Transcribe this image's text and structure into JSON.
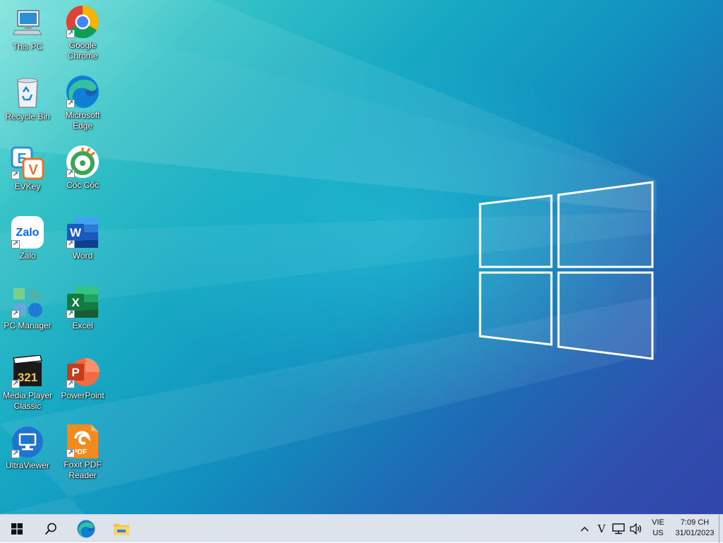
{
  "desktop": {
    "icons": [
      {
        "label": "This PC",
        "icon": "computer-icon",
        "shortcut": false
      },
      {
        "label": "Google Chrome",
        "icon": "chrome-icon",
        "shortcut": true
      },
      {
        "label": "Recycle Bin",
        "icon": "recycle-bin-icon",
        "shortcut": false
      },
      {
        "label": "Microsoft Edge",
        "icon": "edge-icon",
        "shortcut": true
      },
      {
        "label": "EVKey",
        "icon": "evkey-icon",
        "shortcut": true
      },
      {
        "label": "Cốc Cốc",
        "icon": "coccoc-icon",
        "shortcut": true
      },
      {
        "label": "Zalo",
        "icon": "zalo-icon",
        "shortcut": true
      },
      {
        "label": "Word",
        "icon": "word-icon",
        "shortcut": true
      },
      {
        "label": "PC Manager",
        "icon": "pc-manager-icon",
        "shortcut": true
      },
      {
        "label": "Excel",
        "icon": "excel-icon",
        "shortcut": true
      },
      {
        "label": "Media Player Classic",
        "icon": "media-player-icon",
        "shortcut": true
      },
      {
        "label": "PowerPoint",
        "icon": "powerpoint-icon",
        "shortcut": true
      },
      {
        "label": "UltraViewer",
        "icon": "ultraviewer-icon",
        "shortcut": true
      },
      {
        "label": "Foxit PDF Reader",
        "icon": "foxit-pdf-icon",
        "shortcut": true
      }
    ],
    "icon_text": {
      "zalo": "Zalo",
      "word": "W",
      "excel": "X",
      "powerpoint": "P",
      "evkey_e": "E",
      "evkey_v": "V",
      "media_player": "321",
      "foxit": "PDF"
    }
  },
  "taskbar": {
    "pinned": [
      {
        "name": "start-button",
        "icon": "windows-logo-icon"
      },
      {
        "name": "search-button",
        "icon": "search-icon"
      },
      {
        "name": "edge-taskbar-button",
        "icon": "edge-icon"
      },
      {
        "name": "file-explorer-button",
        "icon": "folder-icon"
      }
    ],
    "tray": {
      "chevron": "^",
      "evkey_mode": "V",
      "language_top": "VIE",
      "language_bottom": "US",
      "time": "7:09 CH",
      "date": "31/01/2023"
    }
  },
  "colors": {
    "taskbar_bg": "#dde3ea",
    "desktop_accent": "#1190bf",
    "word_blue": "#185abd",
    "excel_green": "#107c41",
    "powerpoint_red": "#c43e1c"
  }
}
